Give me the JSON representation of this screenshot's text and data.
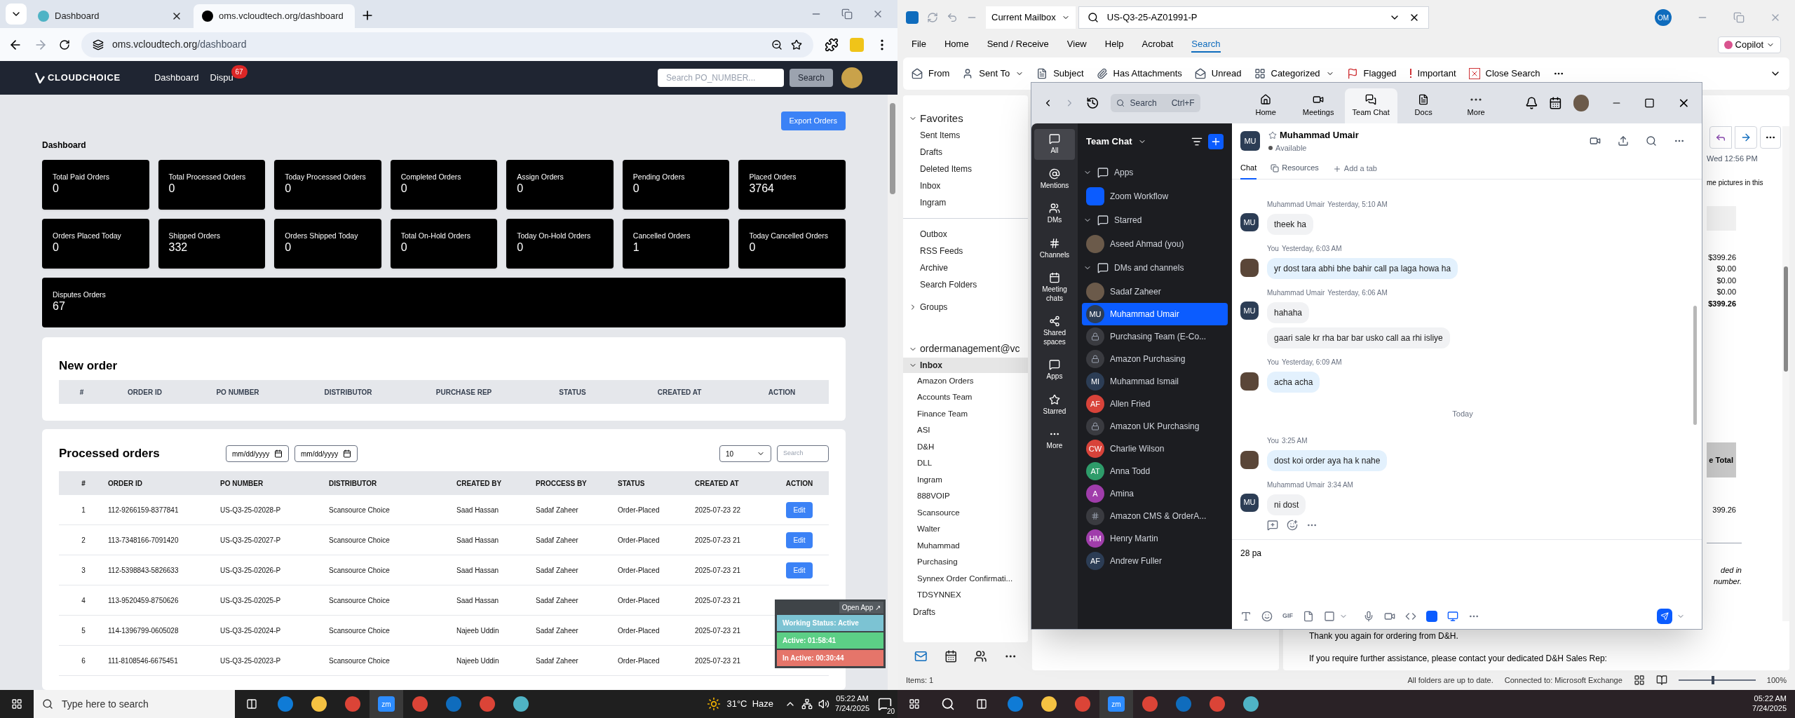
{
  "browser": {
    "tabs": [
      {
        "title": "Dashboard",
        "selected": false
      },
      {
        "title": "oms.vcloudtech.org/dashboard",
        "selected": true
      }
    ],
    "url_host": "oms.vcloudtech.org",
    "url_path": "/dashboard"
  },
  "app": {
    "logo": "CLOUDCHOICE",
    "nav": [
      {
        "label": "Dashboard"
      },
      {
        "label": "Dispu",
        "badge": "67"
      }
    ],
    "search_placeholder": "Search PO_NUMBER...",
    "search_button": "Search",
    "export_button": "Export Orders",
    "heading": "Dashboard",
    "stats": [
      {
        "label": "Total Paid Orders",
        "value": "0"
      },
      {
        "label": "Total Processed Orders",
        "value": "0"
      },
      {
        "label": "Today Processed Orders",
        "value": "0"
      },
      {
        "label": "Completed Orders",
        "value": "0"
      },
      {
        "label": "Assign Orders",
        "value": "0"
      },
      {
        "label": "Pending Orders",
        "value": "0"
      },
      {
        "label": "Placed Orders",
        "value": "3764"
      },
      {
        "label": "Orders Placed Today",
        "value": "0"
      },
      {
        "label": "Shipped Orders",
        "value": "332"
      },
      {
        "label": "Orders Shipped Today",
        "value": "0"
      },
      {
        "label": "Total On-Hold Orders",
        "value": "0"
      },
      {
        "label": "Today On-Hold Orders",
        "value": "0"
      },
      {
        "label": "Cancelled Orders",
        "value": "1"
      },
      {
        "label": "Today Cancelled Orders",
        "value": "0"
      }
    ],
    "disputes": {
      "label": "Disputes Orders",
      "value": "67"
    },
    "new_order": {
      "title": "New order",
      "columns": [
        "#",
        "ORDER ID",
        "PO NUMBER",
        "DISTRIBUTOR",
        "PURCHASE REP",
        "STATUS",
        "CREATED AT",
        "ACTION"
      ]
    },
    "processed": {
      "title": "Processed orders",
      "date_from": "mm/dd/yyyy",
      "date_to": "mm/dd/yyyy",
      "page_size": "10",
      "search_placeholder": "Search",
      "columns": [
        "#",
        "ORDER ID",
        "PO NUMBER",
        "DISTRIBUTOR",
        "CREATED BY",
        "PROCCESS BY",
        "STATUS",
        "CREATED AT",
        "ACTION"
      ],
      "rows": [
        {
          "cells": [
            "1",
            "112-9266159-8377841",
            "US-Q3-25-02028-P",
            "Scansource Choice",
            "Saad Hassan",
            "Sadaf Zaheer",
            "Order-Placed",
            "2025-07-23 22"
          ],
          "action": "Edit"
        },
        {
          "cells": [
            "2",
            "113-7348166-7091420",
            "US-Q3-25-02027-P",
            "Scansource Choice",
            "Saad Hassan",
            "Sadaf Zaheer",
            "Order-Placed",
            "2025-07-23 21"
          ],
          "action": "Edit"
        },
        {
          "cells": [
            "3",
            "112-5398843-5826633",
            "US-Q3-25-02026-P",
            "Scansource Choice",
            "Saad Hassan",
            "Sadaf Zaheer",
            "Order-Placed",
            "2025-07-23 21"
          ],
          "action": "Edit"
        },
        {
          "cells": [
            "4",
            "113-9520459-8750626",
            "US-Q3-25-02025-P",
            "Scansource Choice",
            "Saad Hassan",
            "Sadaf Zaheer",
            "Order-Placed",
            "2025-07-23 21"
          ]
        },
        {
          "cells": [
            "5",
            "114-1396799-0605028",
            "US-Q3-25-02024-P",
            "Scansource Choice",
            "Najeeb Uddin",
            "Sadaf Zaheer",
            "Order-Placed",
            "2025-07-23 21"
          ]
        },
        {
          "cells": [
            "6",
            "111-8108546-6675451",
            "US-Q3-25-02023-P",
            "Scansource Choice",
            "Najeeb Uddin",
            "Sadaf Zaheer",
            "Order-Placed",
            "2025-07-23 21"
          ]
        }
      ]
    }
  },
  "tracker": {
    "open_app": "Open App ↗",
    "bars": [
      {
        "text": "Working Status: Active",
        "color": "#7cc3d3"
      },
      {
        "text": "Active: 01:58:41",
        "color": "#5ccf86"
      },
      {
        "text": "In Active: 00:30:44",
        "color": "#e5756a"
      }
    ]
  },
  "taskbar_left": {
    "search_placeholder": "Type here to search",
    "zoom_label": "zm",
    "weather": "31°C  Haze",
    "time": "05:22 AM",
    "date": "7/24/2025",
    "notifications": "20"
  },
  "outlook": {
    "scope": "Current Mailbox",
    "search_value": "US-Q3-25-AZ01991-P",
    "account_initials": "OM",
    "copilot": "Copilot",
    "menu": [
      {
        "label": "File",
        "selected": false
      },
      {
        "label": "Home",
        "selected": false
      },
      {
        "label": "Send / Receive",
        "selected": false
      },
      {
        "label": "View",
        "selected": false
      },
      {
        "label": "Help",
        "selected": false
      },
      {
        "label": "Acrobat",
        "selected": false
      },
      {
        "label": "Search",
        "selected": true
      }
    ],
    "ribbon": [
      "From",
      "Sent To",
      "Subject",
      "Has Attachments",
      "Unread",
      "Categorized",
      "Flagged",
      "Important",
      "Close Search"
    ],
    "favorites": {
      "label": "Favorites",
      "expanded": true,
      "items": [
        "Sent Items",
        "Drafts",
        "Deleted Items",
        "Inbox",
        "Ingram"
      ]
    },
    "folders": [
      "Outbox",
      "RSS Feeds",
      "Archive",
      "Search Folders"
    ],
    "groups": {
      "label": "Groups",
      "expanded": false
    },
    "account": {
      "label": "ordermanagement@vc",
      "expanded": true
    },
    "inbox": {
      "label": "Inbox",
      "expanded": true,
      "items": [
        "Amazon Orders",
        "Accounts Team",
        "Finance Team",
        "ASI",
        "D&H",
        "DLL",
        "Ingram",
        "888VOIP",
        "Scansource",
        "Walter",
        "Muhammad",
        "Purchasing",
        "Synnex Order Confirmati...",
        "TDSYNNEX"
      ]
    },
    "after_inbox": "Drafts",
    "reading": {
      "date": "Wed 12:56 PM",
      "notice": "me pictures in this",
      "amounts": [
        "$399.26",
        "$0.00",
        "$0.00",
        "$0.00"
      ],
      "total": "$399.26",
      "total_header": "e Total",
      "line_total": "399.26",
      "note_lines": [
        "ded in",
        "number."
      ],
      "body_lines": [
        "Thank you again for ordering from D&H.",
        "If you require further assistance, please contact your dedicated D&H Sales Rep:"
      ]
    },
    "status_items": "Items: 1",
    "status_sync": "All folders are up to date.",
    "status_connection": "Connected to: Microsoft Exchange",
    "zoom_level": "100%",
    "zoom_slider": {
      "level": 0.45
    }
  },
  "zoom": {
    "search": "Search",
    "search_shortcut": "Ctrl+F",
    "tabs": [
      {
        "label": "Home",
        "selected": false
      },
      {
        "label": "Meetings",
        "selected": false
      },
      {
        "label": "Team Chat",
        "selected": true
      },
      {
        "label": "Docs",
        "selected": false
      },
      {
        "label": "More",
        "selected": false
      }
    ],
    "rail": [
      {
        "label": "All",
        "selected": true
      },
      {
        "label": "Mentions",
        "selected": false
      },
      {
        "label": "DMs",
        "selected": false
      },
      {
        "label": "Channels",
        "selected": false
      },
      {
        "label": "Meeting chats",
        "selected": false
      },
      {
        "label": "Shared spaces",
        "selected": false
      },
      {
        "label": "Apps",
        "selected": false
      },
      {
        "label": "Starred",
        "selected": false
      },
      {
        "label": "More",
        "selected": false
      }
    ],
    "list_title": "Team Chat",
    "sections": [
      {
        "label": "Apps",
        "expanded": true,
        "items": [
          {
            "name": "Zoom Workflow",
            "kind": "app",
            "selected": false
          }
        ]
      },
      {
        "label": "Starred",
        "expanded": true,
        "items": [
          {
            "name": "Aseed Ahmad (you)",
            "kind": "photo",
            "selected": false
          }
        ]
      },
      {
        "label": "DMs and channels",
        "expanded": true,
        "items": [
          {
            "name": "Sadaf Zaheer",
            "kind": "photo",
            "selected": false
          },
          {
            "name": "Muhammad Umair",
            "kind": "initials",
            "initials": "MU",
            "color": "#2c3d55",
            "selected": true
          },
          {
            "name": "Purchasing Team (E-Co...",
            "kind": "lock",
            "selected": false
          },
          {
            "name": "Amazon Purchasing",
            "kind": "lock",
            "selected": false
          },
          {
            "name": "Muhammad Ismail",
            "kind": "initials",
            "initials": "MI",
            "color": "#2c3d55",
            "selected": false
          },
          {
            "name": "Allen Fried",
            "kind": "initials",
            "initials": "AF",
            "color": "#d8433a",
            "selected": false
          },
          {
            "name": "Amazon UK Purchasing",
            "kind": "lock",
            "selected": false
          },
          {
            "name": "Charlie Wilson",
            "kind": "initials",
            "initials": "CW",
            "color": "#d8433a",
            "selected": false
          },
          {
            "name": "Anna Todd",
            "kind": "initials",
            "initials": "AT",
            "color": "#2e9c6a",
            "selected": false
          },
          {
            "name": "Amina",
            "kind": "initials",
            "initials": "A",
            "color": "#a03dab",
            "selected": false
          },
          {
            "name": "Amazon CMS & OrderA...",
            "kind": "channel",
            "selected": false
          },
          {
            "name": "Henry Martin",
            "kind": "initials",
            "initials": "HM",
            "color": "#a03dab",
            "selected": false
          },
          {
            "name": "Andrew Fuller",
            "kind": "initials",
            "initials": "AF",
            "color": "#2c3d55",
            "selected": false
          }
        ]
      }
    ],
    "chat": {
      "initials": "MU",
      "name": "Muhammad Umair",
      "presence": "Available",
      "tabs": [
        {
          "label": "Chat",
          "selected": true
        },
        {
          "label": "Resources",
          "selected": false
        }
      ],
      "add_tab": "Add a tab",
      "messages": [
        {
          "kind": "incoming",
          "sender": "Muhammad Umair",
          "time": "Yesterday, 5:10 AM",
          "initials": "MU",
          "bubbles": [
            "theek ha"
          ]
        },
        {
          "kind": "outgoing",
          "sender": "You",
          "time": "Yesterday, 6:03 AM",
          "bubbles": [
            "yr dost tara abhi bhe bahir call pa laga howa ha"
          ]
        },
        {
          "kind": "incoming",
          "sender": "Muhammad Umair",
          "time": "Yesterday, 6:06 AM",
          "initials": "MU",
          "bubbles": [
            "hahaha",
            "gaari sale kr rha bar bar usko call aa rhi isliye"
          ]
        },
        {
          "kind": "outgoing",
          "sender": "You",
          "time": "Yesterday, 6:09 AM",
          "bubbles": [
            "acha acha"
          ]
        },
        {
          "kind": "divider",
          "text": "Today"
        },
        {
          "kind": "outgoing",
          "sender": "You",
          "time": "3:25 AM",
          "bubbles": [
            "dost koi order aya ha k nahe"
          ]
        },
        {
          "kind": "incoming",
          "sender": "Muhammad Umair",
          "time": "3:34 AM",
          "initials": "MU",
          "bubbles": [
            "ni dost"
          ],
          "reactions": true
        }
      ],
      "draft": "28 pa",
      "gif": "GIF"
    }
  },
  "taskbar_right": {
    "zoom_label": "zm",
    "time": "05:22 AM",
    "date": "7/24/2025"
  }
}
